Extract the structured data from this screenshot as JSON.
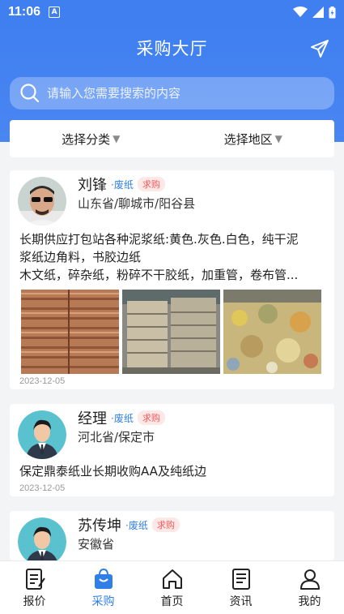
{
  "status": {
    "time": "11:06",
    "notif_glyph": "A"
  },
  "header": {
    "title": "采购大厅",
    "send_icon": "paper-plane-icon"
  },
  "search": {
    "placeholder": "请输入您需要搜索的内容"
  },
  "filters": {
    "category": "选择分类",
    "region": "选择地区"
  },
  "listings": [
    {
      "name": "刘锋",
      "category": "·废纸",
      "tag": "求购",
      "location": "山东省/聊城市/阳谷县",
      "desc_lines": [
        "长期供应打包站各种泥浆纸:黄色.灰色.白色，纯干泥",
        "浆纸边角料，书胶边纸",
        "木文纸，碎杂纸，粉碎不干胶纸，加重管，卷布管..."
      ],
      "date": "2023-12-05"
    },
    {
      "name": "经理",
      "category": "·废纸",
      "tag": "求购",
      "location": "河北省/保定市",
      "desc_lines": [
        "保定鼎泰纸业长期收购AA及纯纸边"
      ],
      "date": "2023-12-05"
    },
    {
      "name": "苏传坤",
      "category": "·废纸",
      "tag": "求购",
      "location": "安徽省",
      "desc_lines": [],
      "date": ""
    }
  ],
  "tabs": [
    {
      "label": "报价",
      "icon": "document-edit-icon",
      "active": false
    },
    {
      "label": "采购",
      "icon": "shopping-bag-icon",
      "active": true
    },
    {
      "label": "首页",
      "icon": "home-icon",
      "active": false
    },
    {
      "label": "资讯",
      "icon": "news-icon",
      "active": false
    },
    {
      "label": "我的",
      "icon": "user-icon",
      "active": false
    }
  ],
  "colors": {
    "primary": "#3f7ff0",
    "active_tab": "#2f7fe6",
    "tag_red": "#f05a5a"
  }
}
